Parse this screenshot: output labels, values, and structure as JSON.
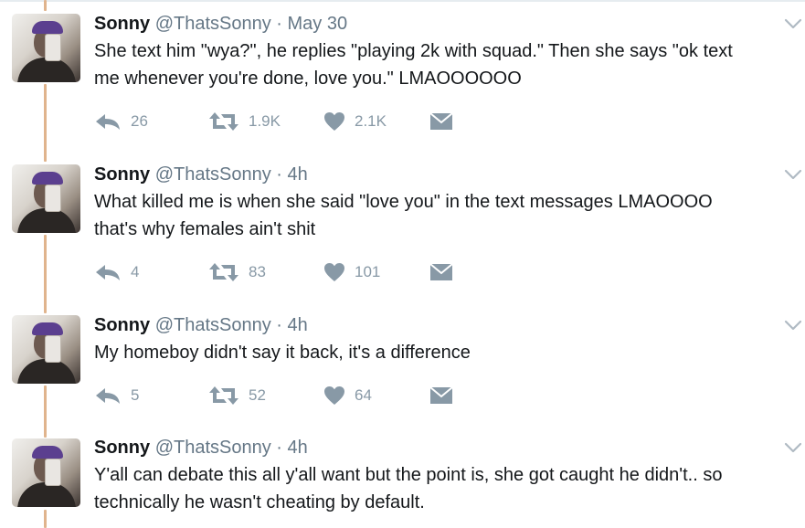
{
  "tweets": [
    {
      "name": "Sonny",
      "handle": "@ThatsSonny",
      "separator": "·",
      "time": "May 30",
      "text_lines": [
        "She text him \"wya?\", he replies \"playing 2k with squad.\" Then she says \"ok text",
        "me whenever you're done, love you.\" LMAOOOOOO"
      ],
      "replies": "26",
      "retweets": "1.9K",
      "likes": "2.1K"
    },
    {
      "name": "Sonny",
      "handle": "@ThatsSonny",
      "separator": "·",
      "time": "4h",
      "text_lines": [
        "What killed me is when she said \"love you\" in the text messages LMAOOOO",
        "that's why females ain't shit"
      ],
      "replies": "4",
      "retweets": "83",
      "likes": "101"
    },
    {
      "name": "Sonny",
      "handle": "@ThatsSonny",
      "separator": "·",
      "time": "4h",
      "text_lines": [
        "My homeboy didn't say it back, it's a difference"
      ],
      "replies": "5",
      "retweets": "52",
      "likes": "64"
    },
    {
      "name": "Sonny",
      "handle": "@ThatsSonny",
      "separator": "·",
      "time": "4h",
      "text_lines": [
        "Y'all can debate this all y'all want but the point is, she got caught he didn't.. so",
        "technically he wasn't cheating by default."
      ]
    }
  ],
  "icons": {
    "reply": "reply-icon",
    "retweet": "retweet-icon",
    "like": "heart-icon",
    "dm": "envelope-icon",
    "menu": "chevron-down-icon"
  },
  "colors": {
    "thread_line": "#e0b48d",
    "muted": "#8899a6",
    "text": "#14171a",
    "meta": "#657786"
  }
}
